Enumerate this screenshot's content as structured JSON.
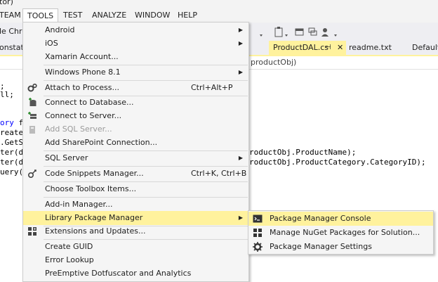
{
  "window": {
    "title_fragment": "tor)"
  },
  "menubar": {
    "team": "TEAM",
    "tools": "TOOLS",
    "test": "TEST",
    "analyze": "ANALYZE",
    "window": "WINDOW",
    "help": "HELP"
  },
  "toolbar": {
    "browser_fragment": "le Chro"
  },
  "tabs": [
    {
      "label": "onstat."
    },
    {
      "label": "ProductDAL.cs"
    },
    {
      "label": "readme.txt"
    },
    {
      "label": "Default.a"
    }
  ],
  "navbar": {
    "member_fragment": "productObj)"
  },
  "code": {
    "lines": [
      {
        "prefix": "",
        "keyword": "",
        "rest": ";"
      },
      {
        "prefix": "",
        "keyword": "",
        "rest": "ll;"
      },
      {
        "prefix": "",
        "keyword": "ory",
        "rest": " fa"
      },
      {
        "prefix": "reate(",
        "keyword": "",
        "rest": ""
      },
      {
        "prefix": ".GetSt",
        "keyword": "",
        "rest": ""
      },
      {
        "prefix": "ter(db",
        "keyword": "",
        "rest": ""
      },
      {
        "prefix": "ter(db",
        "keyword": "",
        "rest": ""
      },
      {
        "prefix": "uery(d",
        "keyword": "",
        "rest": ""
      }
    ],
    "right_lines": [
      "roductObj.ProductName);",
      "roductObj.ProductCategory.CategoryID);"
    ]
  },
  "tools_menu": {
    "items": [
      {
        "label": "Android",
        "shortcut": "",
        "submenu": true,
        "icon": "",
        "disabled": false
      },
      {
        "label": "iOS",
        "shortcut": "",
        "submenu": true,
        "icon": "",
        "disabled": false
      },
      {
        "label": "Xamarin Account...",
        "shortcut": "",
        "submenu": false,
        "icon": "",
        "disabled": false
      },
      {
        "label": "Windows Phone 8.1",
        "shortcut": "",
        "submenu": true,
        "icon": "",
        "disabled": false
      },
      {
        "label": "Attach to Process...",
        "shortcut": "Ctrl+Alt+P",
        "submenu": false,
        "icon": "gears-icon",
        "disabled": false
      },
      {
        "label": "Connect to Database...",
        "shortcut": "",
        "submenu": false,
        "icon": "database-plus-icon",
        "disabled": false
      },
      {
        "label": "Connect to Server...",
        "shortcut": "",
        "submenu": false,
        "icon": "server-plus-icon",
        "disabled": false
      },
      {
        "label": "Add SQL Server...",
        "shortcut": "",
        "submenu": false,
        "icon": "sql-server-icon",
        "disabled": true
      },
      {
        "label": "Add SharePoint Connection...",
        "shortcut": "",
        "submenu": false,
        "icon": "",
        "disabled": false
      },
      {
        "label": "SQL Server",
        "shortcut": "",
        "submenu": true,
        "icon": "",
        "disabled": false
      },
      {
        "label": "Code Snippets Manager...",
        "shortcut": "Ctrl+K, Ctrl+B",
        "submenu": false,
        "icon": "snippets-icon",
        "disabled": false
      },
      {
        "label": "Choose Toolbox Items...",
        "shortcut": "",
        "submenu": false,
        "icon": "",
        "disabled": false
      },
      {
        "label": "Add-in Manager...",
        "shortcut": "",
        "submenu": false,
        "icon": "",
        "disabled": false
      },
      {
        "label": "Library Package Manager",
        "shortcut": "",
        "submenu": true,
        "icon": "",
        "disabled": false
      },
      {
        "label": "Extensions and Updates...",
        "shortcut": "",
        "submenu": false,
        "icon": "extensions-icon",
        "disabled": false
      },
      {
        "label": "Create GUID",
        "shortcut": "",
        "submenu": false,
        "icon": "",
        "disabled": false
      },
      {
        "label": "Error Lookup",
        "shortcut": "",
        "submenu": false,
        "icon": "",
        "disabled": false
      },
      {
        "label": "PreEmptive Dotfuscator and Analytics",
        "shortcut": "",
        "submenu": false,
        "icon": "",
        "disabled": false
      }
    ]
  },
  "package_submenu": {
    "items": [
      {
        "label": "Package Manager Console",
        "icon": "console-icon"
      },
      {
        "label": "Manage NuGet Packages for Solution...",
        "icon": "nuget-icon"
      },
      {
        "label": "Package Manager Settings",
        "icon": "settings-gear-icon"
      }
    ]
  },
  "colors": {
    "highlight": "#fff29d",
    "menu_bg": "#f5f5f5",
    "chrome": "#eeeef2",
    "keyword": "#0000ff"
  }
}
